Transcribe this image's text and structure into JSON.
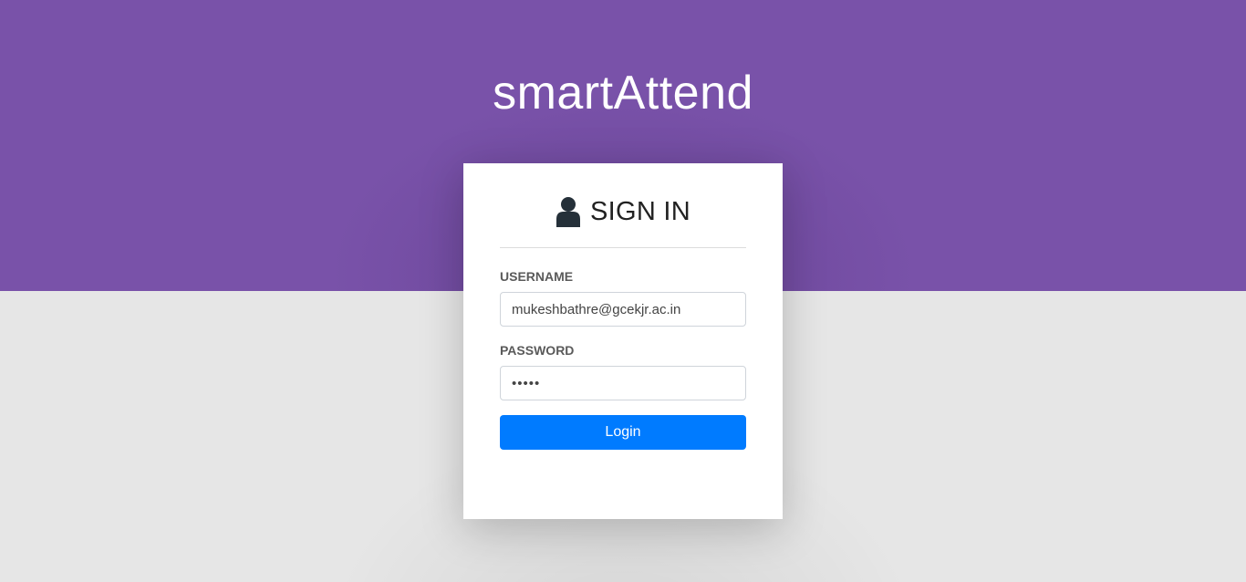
{
  "app": {
    "title": "smartAttend"
  },
  "login_card": {
    "heading": "SIGN IN",
    "icon": "user-icon",
    "username": {
      "label": "USERNAME",
      "value": "mukeshbathre@gcekjr.ac.in"
    },
    "password": {
      "label": "PASSWORD",
      "value": "•••••"
    },
    "login_button_label": "Login"
  },
  "colors": {
    "header_background": "#7952a9",
    "page_background": "#e6e6e6",
    "primary_button": "#007bff"
  }
}
